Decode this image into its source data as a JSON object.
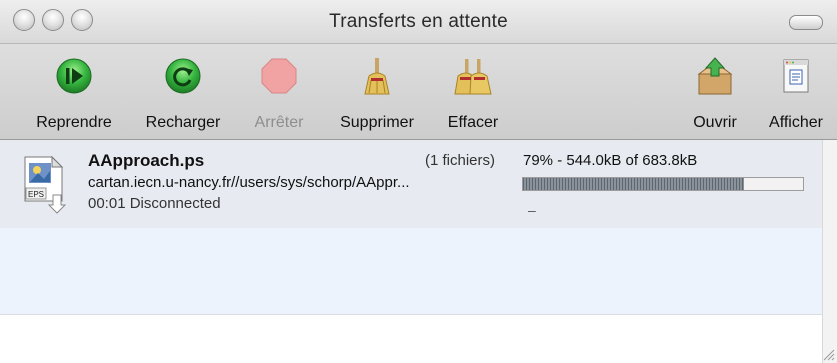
{
  "window": {
    "title": "Transferts en attente"
  },
  "toolbar": {
    "items": [
      {
        "label": "Reprendre",
        "icon": "resume-icon",
        "enabled": true
      },
      {
        "label": "Recharger",
        "icon": "reload-icon",
        "enabled": true
      },
      {
        "label": "Arrêter",
        "icon": "stop-icon",
        "enabled": false
      },
      {
        "label": "Supprimer",
        "icon": "broom-icon",
        "enabled": true
      },
      {
        "label": "Effacer",
        "icon": "double-broom-icon",
        "enabled": true
      },
      {
        "label": "Ouvrir",
        "icon": "open-box-icon",
        "enabled": true
      },
      {
        "label": "Afficher",
        "icon": "show-document-icon",
        "enabled": true
      }
    ]
  },
  "transfers": [
    {
      "name": "AApproach.ps",
      "count": "(1 fichiers)",
      "url": "cartan.iecn.u-nancy.fr//users/sys/schorp/AAppr...",
      "status": "00:01 Disconnected",
      "progress_text": "79% - 544.0kB of 683.8kB",
      "progress": 0.79,
      "sub_status": "–",
      "file_icon_label": "EPS"
    }
  ],
  "colors": {
    "row_selected": "#e7ebf1",
    "row_alt": "#ecf3fc",
    "resume_green": "#2fa93a",
    "stop_red": "#e26b6b"
  }
}
